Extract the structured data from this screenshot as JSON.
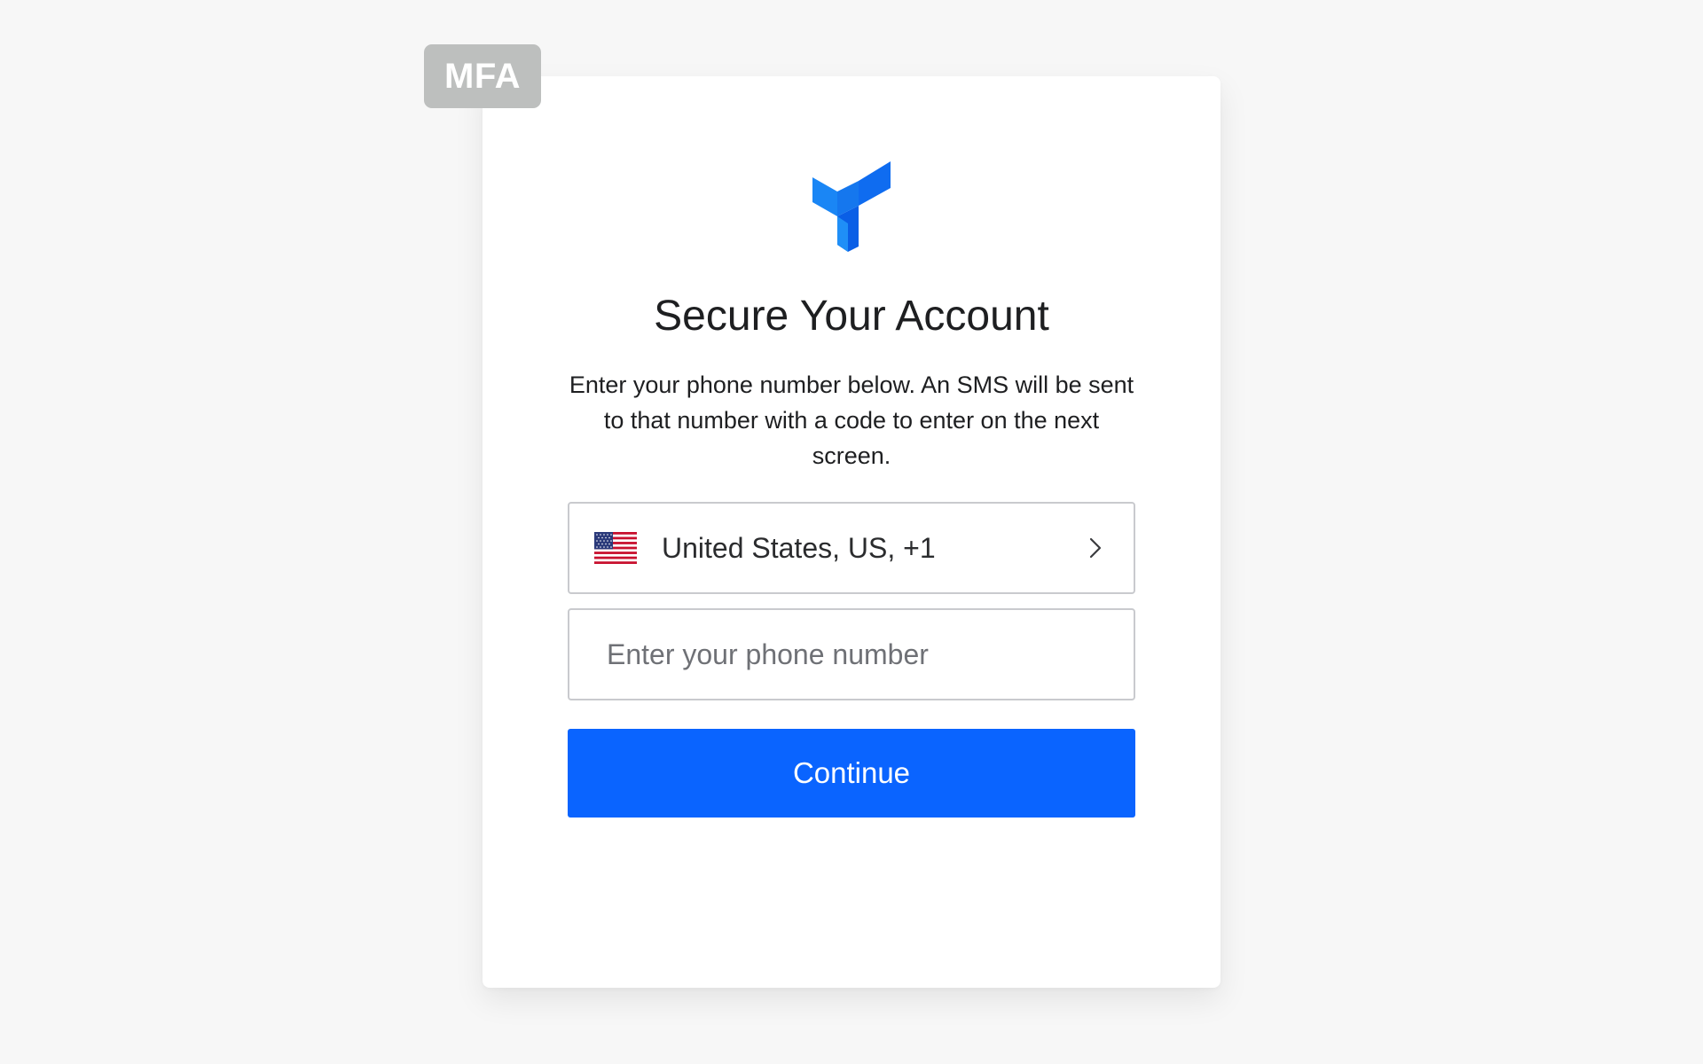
{
  "badge": {
    "label": "MFA"
  },
  "brand": {
    "logo_icon": "brand-logo-icon",
    "accent_color": "#0a64ff"
  },
  "header": {
    "title": "Secure Your Account"
  },
  "description": "Enter your phone number below. An SMS will be sent to that number with a code to enter on the next screen.",
  "country_selector": {
    "flag_icon": "us-flag-icon",
    "label": "United States, US, +1",
    "chevron_icon": "chevron-right-icon"
  },
  "phone_field": {
    "value": "",
    "placeholder": "Enter your phone number"
  },
  "continue_button": {
    "label": "Continue"
  }
}
